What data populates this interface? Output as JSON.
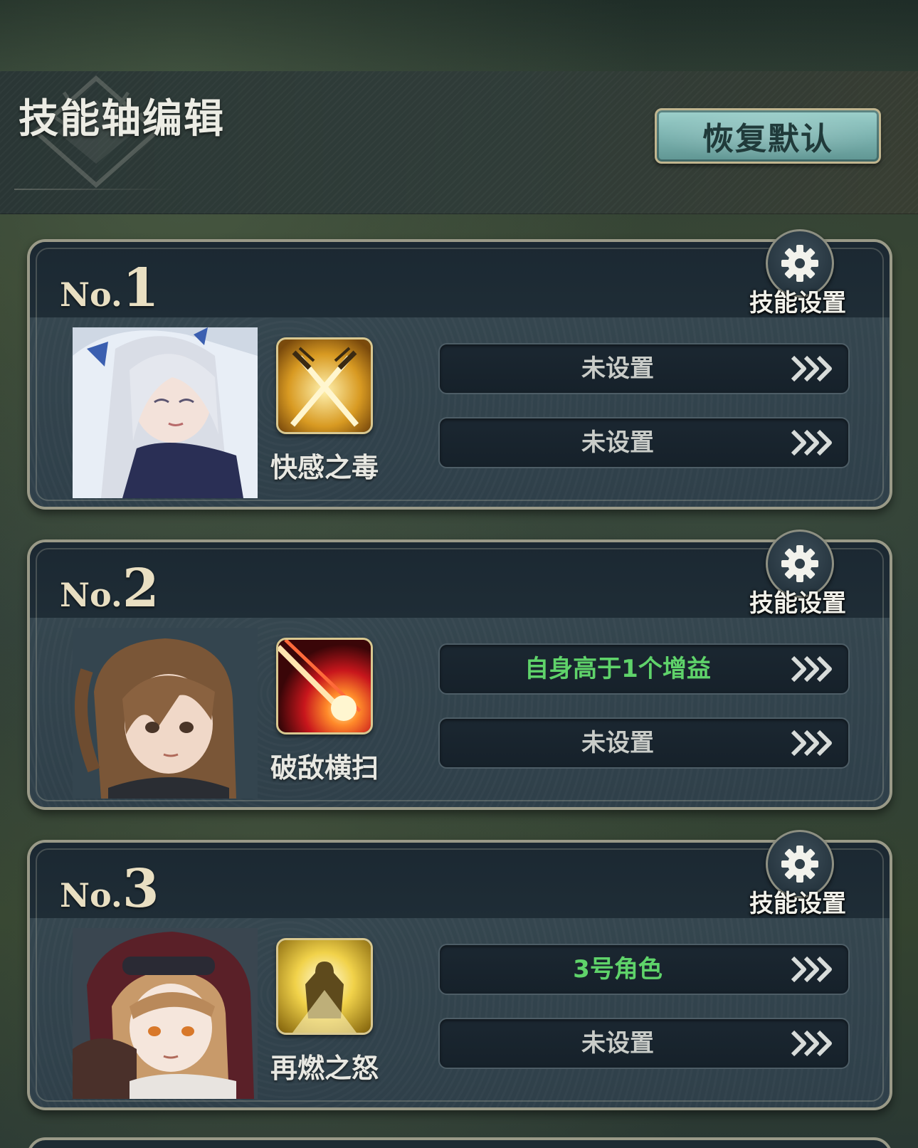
{
  "header": {
    "title": "技能轴编辑",
    "reset_label": "恢复默认"
  },
  "colors": {
    "condition_set": "#5fd36a",
    "condition_unset": "#c9ccc8",
    "button_teal": "#7cb3b0",
    "frame_gold": "#9a9a88"
  },
  "cards": [
    {
      "no_prefix": "No.",
      "no_number": "1",
      "settings_label": "技能设置",
      "settings_icon": "gear-icon",
      "character": "silver-haired-maid-portrait",
      "skill_icon": "crossed-swords-icon",
      "skill_name": "快感之毒",
      "conditions": [
        {
          "text": "未设置",
          "set": false
        },
        {
          "text": "未设置",
          "set": false
        }
      ]
    },
    {
      "no_prefix": "No.",
      "no_number": "2",
      "settings_label": "技能设置",
      "settings_icon": "gear-icon",
      "character": "brown-ponytail-girl-portrait",
      "skill_icon": "red-slash-icon",
      "skill_name": "破敌横扫",
      "conditions": [
        {
          "text": "自身高于1个增益",
          "set": true
        },
        {
          "text": "未设置",
          "set": false
        }
      ]
    },
    {
      "no_prefix": "No.",
      "no_number": "3",
      "settings_label": "技能设置",
      "settings_icon": "gear-icon",
      "character": "red-hood-girl-portrait",
      "skill_icon": "golden-knight-icon",
      "skill_name": "再燃之怒",
      "conditions": [
        {
          "text": "3号角色",
          "set": true
        },
        {
          "text": "未设置",
          "set": false
        }
      ]
    }
  ]
}
